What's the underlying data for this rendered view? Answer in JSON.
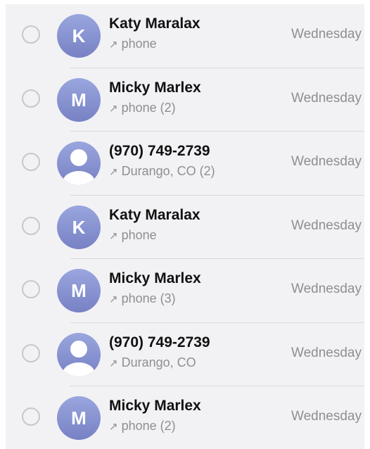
{
  "calls": [
    {
      "name": "Katy Maralax",
      "avatar_type": "initial",
      "initial": "K",
      "direction_icon": "outgoing-arrow",
      "arrow": "↗",
      "detail": "phone",
      "time": "Wednesday"
    },
    {
      "name": "Micky Marlex",
      "avatar_type": "initial",
      "initial": "M",
      "direction_icon": "outgoing-arrow",
      "arrow": "↗",
      "detail": "phone (2)",
      "time": "Wednesday"
    },
    {
      "name": "(970) 749-2739",
      "avatar_type": "person-silhouette",
      "initial": "",
      "direction_icon": "outgoing-arrow",
      "arrow": "↗",
      "detail": "Durango, CO (2)",
      "time": "Wednesday"
    },
    {
      "name": "Katy Maralax",
      "avatar_type": "initial",
      "initial": "K",
      "direction_icon": "outgoing-arrow",
      "arrow": "↗",
      "detail": "phone",
      "time": "Wednesday"
    },
    {
      "name": "Micky Marlex",
      "avatar_type": "initial",
      "initial": "M",
      "direction_icon": "outgoing-arrow",
      "arrow": "↗",
      "detail": "phone (3)",
      "time": "Wednesday"
    },
    {
      "name": "(970) 749-2739",
      "avatar_type": "person-silhouette",
      "initial": "",
      "direction_icon": "outgoing-arrow",
      "arrow": "↗",
      "detail": "Durango, CO",
      "time": "Wednesday"
    },
    {
      "name": "Micky Marlex",
      "avatar_type": "initial",
      "initial": "M",
      "direction_icon": "outgoing-arrow",
      "arrow": "↗",
      "detail": "phone (2)",
      "time": "Wednesday"
    }
  ],
  "colors": {
    "background": "#f2f2f5",
    "avatar_gradient_top": "#9aa6de",
    "avatar_gradient_bottom": "#7781c4",
    "primary_text": "#111111",
    "secondary_text": "#8e8e93",
    "select_circle": "#c7c7cc",
    "separator": "#d9d9de"
  }
}
